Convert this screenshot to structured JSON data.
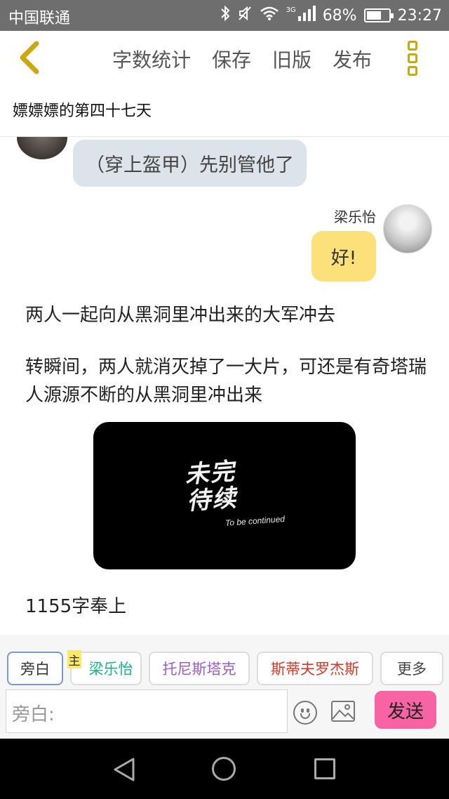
{
  "status_bar": {
    "carrier": "中国联通",
    "network": "3G",
    "battery": "68%",
    "battery_level": 0.68,
    "time": "23:27"
  },
  "header": {
    "menu": [
      "字数统计",
      "保存",
      "旧版",
      "发布"
    ],
    "title": "嫖嫖嫖的第四十七天"
  },
  "chat": {
    "left_bubble": "（穿上盔甲）先别管他了",
    "right_name": "梁乐怡",
    "right_bubble": "好!"
  },
  "narration": {
    "p1": "两人一起向从黑洞里冲出来的大军冲去",
    "p2": "转瞬间，两人就消灭掉了一大片，可还是有奇塔瑞人源源不断的从黑洞里冲出来"
  },
  "image_card": {
    "line1": "未完",
    "line2": "待续",
    "subtitle": "To be continued"
  },
  "footer_text": "1155字奉上",
  "characters": {
    "narrator": "旁白",
    "badge": "主",
    "char1": "梁乐怡",
    "char2": "托尼斯塔克",
    "char3": "斯蒂夫罗杰斯",
    "more": "更多"
  },
  "composer": {
    "placeholder": "旁白:",
    "send": "发送"
  },
  "colors": {
    "accent_yellow": "#fce07a",
    "send_pink": "#f763a3",
    "char1": "#1aaf8f",
    "char2": "#9c5dc8",
    "char3": "#d43a2a"
  }
}
